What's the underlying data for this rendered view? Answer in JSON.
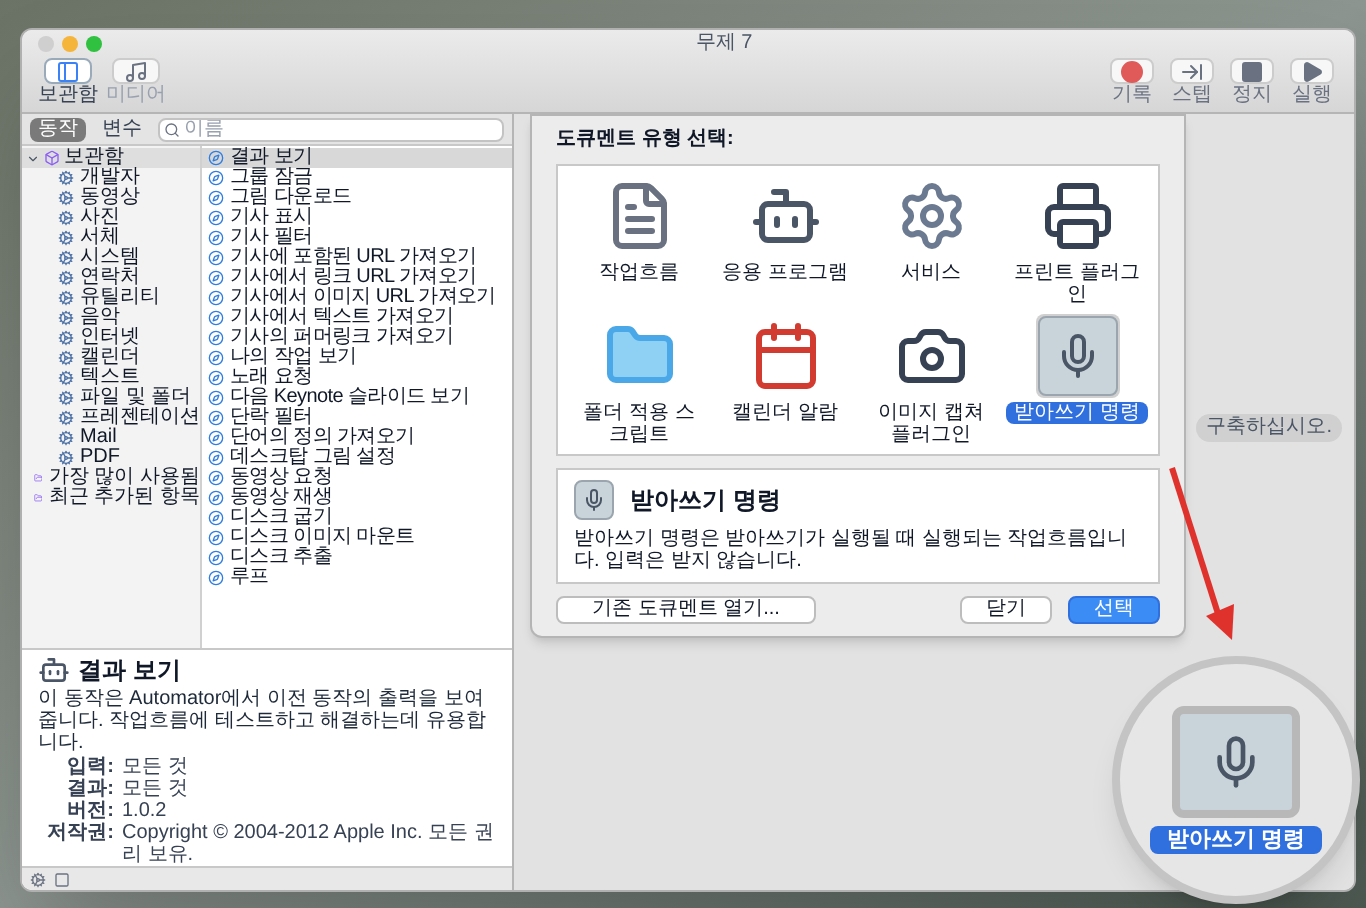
{
  "window": {
    "title": "무제 7"
  },
  "toolbar_left": [
    {
      "label": "보관함",
      "kind": "library",
      "selected": true
    },
    {
      "label": "미디어",
      "kind": "media",
      "selected": false
    }
  ],
  "toolbar_right": [
    {
      "label": "기록",
      "kind": "record"
    },
    {
      "label": "스텝",
      "kind": "step"
    },
    {
      "label": "정지",
      "kind": "stop"
    },
    {
      "label": "실행",
      "kind": "run"
    }
  ],
  "segments": [
    {
      "label": "동작",
      "selected": true
    },
    {
      "label": "변수",
      "selected": false
    }
  ],
  "search": {
    "placeholder": "이름"
  },
  "library": {
    "root": {
      "label": "보관함",
      "expanded": true,
      "children": [
        {
          "label": "개발자"
        },
        {
          "label": "동영상"
        },
        {
          "label": "사진"
        },
        {
          "label": "서체"
        },
        {
          "label": "시스템"
        },
        {
          "label": "연락처"
        },
        {
          "label": "유틸리티"
        },
        {
          "label": "음악"
        },
        {
          "label": "인터넷"
        },
        {
          "label": "캘린더"
        },
        {
          "label": "텍스트"
        },
        {
          "label": "파일 및 폴더"
        },
        {
          "label": "프레젠테이션"
        },
        {
          "label": "Mail"
        },
        {
          "label": "PDF"
        }
      ]
    },
    "smart_groups": [
      {
        "label": "가장 많이 사용됨"
      },
      {
        "label": "최근 추가된 항목"
      }
    ]
  },
  "actions": [
    {
      "label": "결과 보기",
      "selected": true
    },
    {
      "label": "그룹 잠금",
      "selected": false
    },
    {
      "label": "그림 다운로드",
      "selected": false
    },
    {
      "label": "기사 표시",
      "selected": false
    },
    {
      "label": "기사 필터",
      "selected": false
    },
    {
      "label": "기사에 포함된 URL 가져오기",
      "selected": false
    },
    {
      "label": "기사에서 링크 URL 가져오기",
      "selected": false
    },
    {
      "label": "기사에서 이미지 URL 가져오기",
      "selected": false
    },
    {
      "label": "기사에서 텍스트 가져오기",
      "selected": false
    },
    {
      "label": "기사의 퍼머링크 가져오기",
      "selected": false
    },
    {
      "label": "나의 작업 보기",
      "selected": false
    },
    {
      "label": "노래 요청",
      "selected": false
    },
    {
      "label": "다음 Keynote 슬라이드 보기",
      "selected": false
    },
    {
      "label": "단락 필터",
      "selected": false
    },
    {
      "label": "단어의 정의 가져오기",
      "selected": false
    },
    {
      "label": "데스크탑 그림 설정",
      "selected": false
    },
    {
      "label": "동영상 요청",
      "selected": false
    },
    {
      "label": "동영상 재생",
      "selected": false
    },
    {
      "label": "디스크 굽기",
      "selected": false
    },
    {
      "label": "디스크 이미지 마운트",
      "selected": false
    },
    {
      "label": "디스크 추출",
      "selected": false
    },
    {
      "label": "루프",
      "selected": false
    }
  ],
  "description": {
    "title": "결과 보기",
    "text": "이 동작은 Automator에서 이전 동작의 출력을 보여줍니다. 작업흐름에 테스트하고 해결하는데 유용합니다.",
    "fields": [
      {
        "label": "입력:",
        "value": "모든 것"
      },
      {
        "label": "결과:",
        "value": "모든 것"
      },
      {
        "label": "버전:",
        "value": "1.0.2"
      },
      {
        "label": "저작권:",
        "value": "Copyright © 2004-2012 Apple Inc. 모든 권리 보유."
      }
    ]
  },
  "canvas_hint": "구축하십시오.",
  "dialog": {
    "title": "도큐멘트 유형 선택:",
    "types": [
      {
        "label": "작업흐름",
        "kind": "workflow",
        "selected": false
      },
      {
        "label": "응용 프로그램",
        "kind": "application",
        "selected": false
      },
      {
        "label": "서비스",
        "kind": "service",
        "selected": false
      },
      {
        "label": "프린트 플러그인",
        "kind": "print",
        "selected": false
      },
      {
        "label": "폴더 적용 스크립트",
        "kind": "folder",
        "selected": false
      },
      {
        "label": "캘린더 알람",
        "kind": "calendar",
        "selected": false
      },
      {
        "label": "이미지 캡쳐 플러그인",
        "kind": "capture",
        "selected": false
      },
      {
        "label": "받아쓰기 명령",
        "kind": "dictation",
        "selected": true
      }
    ],
    "detail": {
      "title": "받아쓰기 명령",
      "text": "받아쓰기 명령은 받아쓰기가 실행될 때 실행되는 작업흐름입니다. 입력은 받지 않습니다."
    },
    "buttons": [
      {
        "label": "기존 도큐멘트 열기...",
        "kind": "secondary"
      },
      {
        "label": "닫기",
        "kind": "secondary"
      },
      {
        "label": "선택",
        "kind": "primary"
      }
    ]
  },
  "callout": {
    "label": "받아쓰기 명령"
  }
}
